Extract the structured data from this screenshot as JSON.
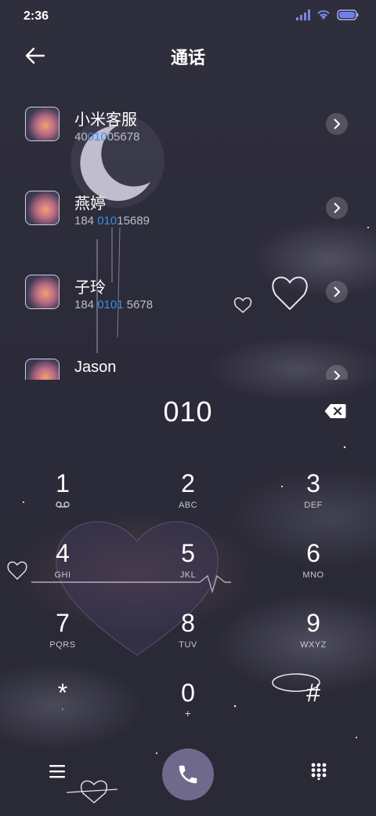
{
  "status_bar": {
    "time": "2:36",
    "icons": [
      "signal-icon",
      "wifi-icon",
      "battery-icon"
    ]
  },
  "header": {
    "title": "通话",
    "back_icon": "back-arrow-icon"
  },
  "contacts": [
    {
      "name": "小米客服",
      "number_pre": "40",
      "number_hl": "010",
      "number_post": "05678"
    },
    {
      "name": "燕婷",
      "number_pre": "184 ",
      "number_hl": "010",
      "number_post": "15689"
    },
    {
      "name": "子玲",
      "number_pre": "184 ",
      "number_hl": "0101",
      "number_post": " 5678"
    },
    {
      "name": "Jason",
      "number_pre": "",
      "number_hl": "",
      "number_post": ""
    }
  ],
  "dialer": {
    "input": "010",
    "keys": [
      {
        "digit": "1",
        "letters": ""
      },
      {
        "digit": "2",
        "letters": "ABC"
      },
      {
        "digit": "3",
        "letters": "DEF"
      },
      {
        "digit": "4",
        "letters": "GHI"
      },
      {
        "digit": "5",
        "letters": "JKL"
      },
      {
        "digit": "6",
        "letters": "MNO"
      },
      {
        "digit": "7",
        "letters": "PQRS"
      },
      {
        "digit": "8",
        "letters": "TUV"
      },
      {
        "digit": "9",
        "letters": "WXYZ"
      },
      {
        "digit": "*",
        "letters": ","
      },
      {
        "digit": "0",
        "letters": "+"
      },
      {
        "digit": "#",
        "letters": ""
      }
    ]
  },
  "colors": {
    "background": "#2d2c3b",
    "highlight": "#3a8fe8",
    "call_button": "#6f6a8c"
  }
}
